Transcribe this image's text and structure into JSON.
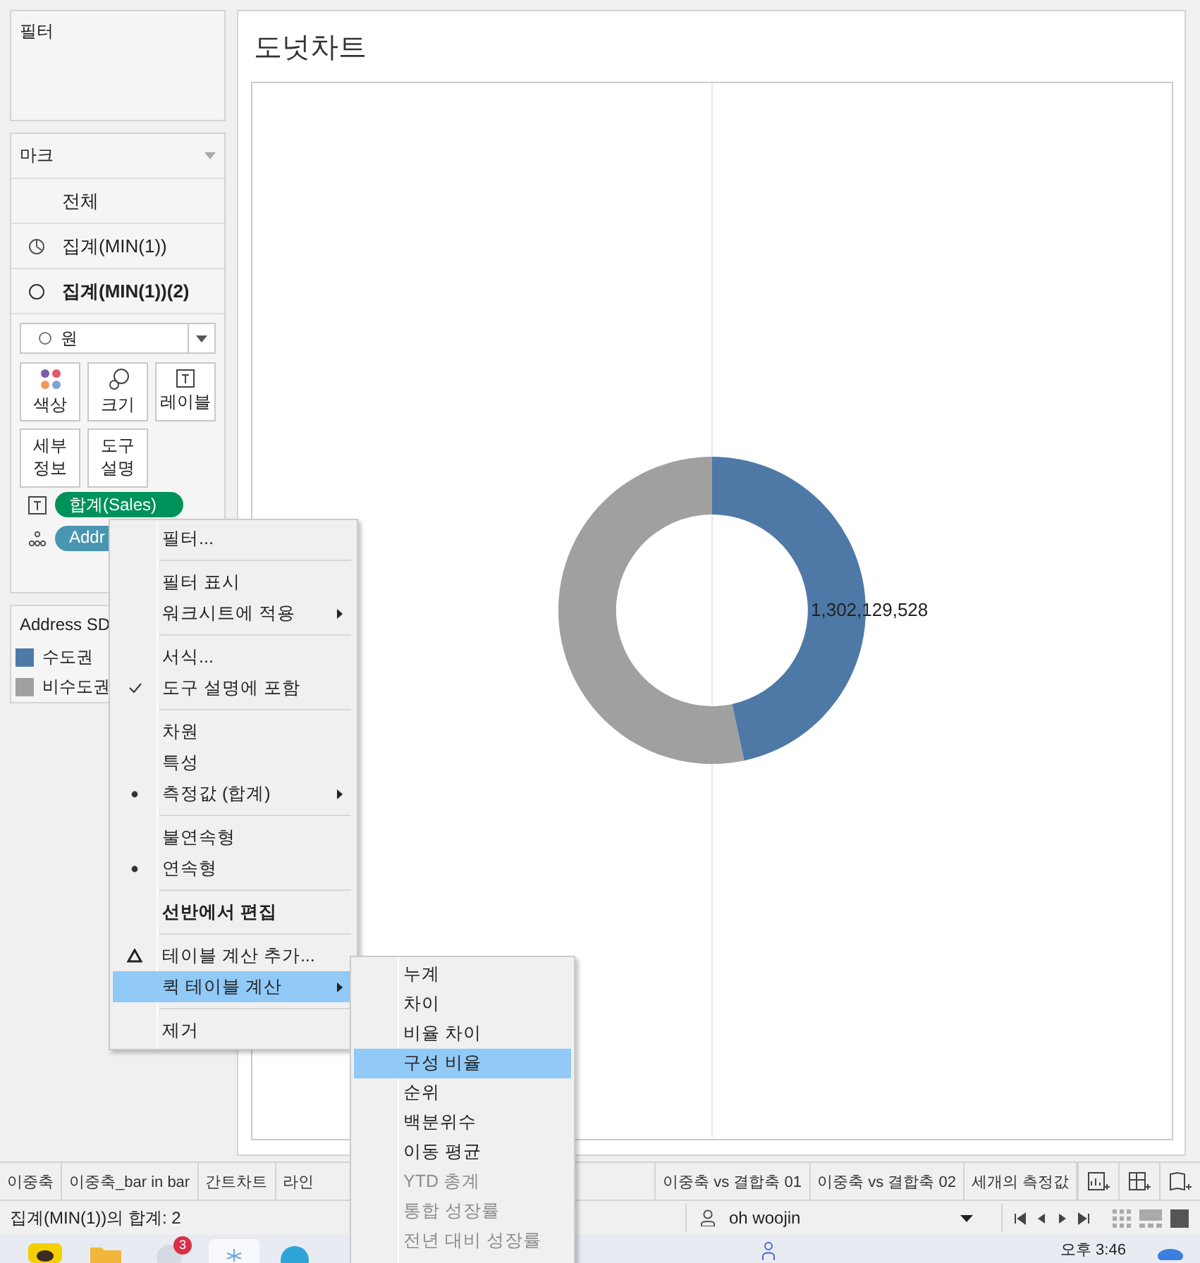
{
  "filter_card": {
    "title": "필터"
  },
  "marks_card": {
    "title": "마크",
    "layers": [
      {
        "label": "전체",
        "selected": false
      },
      {
        "label": "집계(MIN(1))",
        "selected": false
      },
      {
        "label": "집계(MIN(1))(2)",
        "selected": true
      }
    ],
    "mark_type": "원",
    "buttons": [
      {
        "label": "색상"
      },
      {
        "label": "크기"
      },
      {
        "label": "레이블"
      },
      {
        "label": "세부 정보"
      },
      {
        "label": "도구 설명"
      }
    ],
    "pills": [
      {
        "label": "합계(Sales)",
        "color": "#00925c"
      },
      {
        "label": "Addr",
        "color": "#4996b2"
      }
    ]
  },
  "legend": {
    "title": "Address SD",
    "items": [
      {
        "label": "수도권",
        "color": "#4e79a7"
      },
      {
        "label": "비수도권",
        "color": "#a0a0a0"
      }
    ]
  },
  "sheet": {
    "title": "도넛차트",
    "label": "1,302,129,528"
  },
  "context_menu": {
    "items": [
      {
        "kind": "item",
        "label": "필터...",
        "submenu": false,
        "selected": false,
        "bold": false
      },
      {
        "kind": "separator"
      },
      {
        "kind": "item",
        "label": "필터 표시",
        "submenu": false,
        "selected": false,
        "bold": false
      },
      {
        "kind": "item",
        "label": "워크시트에 적용",
        "submenu": true,
        "selected": false,
        "bold": false
      },
      {
        "kind": "separator"
      },
      {
        "kind": "item",
        "label": "서식...",
        "submenu": false,
        "selected": false,
        "bold": false
      },
      {
        "kind": "check",
        "label": "도구 설명에 포함",
        "submenu": false,
        "selected": false,
        "bold": false
      },
      {
        "kind": "separator"
      },
      {
        "kind": "item",
        "label": "차원",
        "submenu": false,
        "selected": false,
        "bold": false
      },
      {
        "kind": "item",
        "label": "특성",
        "submenu": false,
        "selected": false,
        "bold": false
      },
      {
        "kind": "radio",
        "label": "측정값 (합계)",
        "submenu": true,
        "selected": false,
        "bold": false
      },
      {
        "kind": "separator"
      },
      {
        "kind": "item",
        "label": "불연속형",
        "submenu": false,
        "selected": false,
        "bold": false
      },
      {
        "kind": "radio",
        "label": "연속형",
        "submenu": false,
        "selected": false,
        "bold": false
      },
      {
        "kind": "separator"
      },
      {
        "kind": "item",
        "label": "선반에서 편집",
        "submenu": false,
        "selected": false,
        "bold": true
      },
      {
        "kind": "separator"
      },
      {
        "kind": "calc",
        "label": "테이블 계산 추가...",
        "submenu": false,
        "selected": false,
        "bold": false
      },
      {
        "kind": "item",
        "label": "퀵 테이블 계산",
        "submenu": true,
        "selected": true,
        "bold": false
      },
      {
        "kind": "separator"
      },
      {
        "kind": "item",
        "label": "제거",
        "submenu": false,
        "selected": false,
        "bold": false
      }
    ]
  },
  "submenu": {
    "items": [
      {
        "label": "누계",
        "selected": false,
        "disabled": false
      },
      {
        "label": "차이",
        "selected": false,
        "disabled": false
      },
      {
        "label": "비율 차이",
        "selected": false,
        "disabled": false
      },
      {
        "label": "구성 비율",
        "selected": true,
        "disabled": false
      },
      {
        "label": "순위",
        "selected": false,
        "disabled": false
      },
      {
        "label": "백분위수",
        "selected": false,
        "disabled": false
      },
      {
        "label": "이동 평균",
        "selected": false,
        "disabled": false
      },
      {
        "label": "YTD 총계",
        "selected": false,
        "disabled": true
      },
      {
        "label": "통합 성장률",
        "selected": false,
        "disabled": true
      },
      {
        "label": "전년 대비 성장률",
        "selected": false,
        "disabled": true
      }
    ]
  },
  "sheet_tabs": [
    {
      "label": "이중축"
    },
    {
      "label": "이중축_bar in bar"
    },
    {
      "label": "간트차트"
    },
    {
      "label": "라인"
    },
    {
      "label": "이중축 vs 결합축 01"
    },
    {
      "label": "이중축 vs 결합축 02"
    },
    {
      "label": "세개의 측정값"
    }
  ],
  "status_bar": {
    "text": "집계(MIN(1))의 합계: 2",
    "user": "oh woojin"
  },
  "taskbar": {
    "badge": "3",
    "clock": "오후 3:46"
  }
}
